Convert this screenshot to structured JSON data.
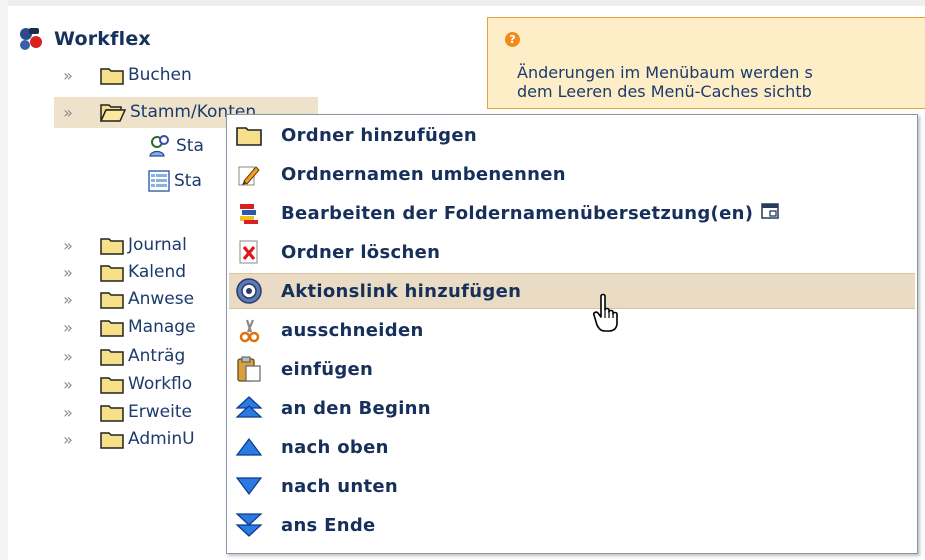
{
  "tree": {
    "root_label": "Workflex",
    "items": [
      {
        "label": "Buchen",
        "expanded": false
      },
      {
        "label": "Stamm/Konten",
        "expanded": true
      },
      {
        "label": "Journal",
        "expanded": false
      },
      {
        "label": "Kalend",
        "expanded": false
      },
      {
        "label": "Anwese",
        "expanded": false
      },
      {
        "label": "Manage",
        "expanded": false
      },
      {
        "label": "Anträg",
        "expanded": false
      },
      {
        "label": "Workflo",
        "expanded": false
      },
      {
        "label": "Erweite",
        "expanded": false
      },
      {
        "label": "AdminU",
        "expanded": false
      }
    ],
    "subitems": [
      {
        "label": "Sta",
        "icon": "users-icon"
      },
      {
        "label": "Sta",
        "icon": "list-icon"
      }
    ]
  },
  "info": {
    "line1": "Änderungen im Menübaum werden s",
    "line2": "dem Leeren des Menü-Caches sichtb"
  },
  "context_menu": {
    "items": [
      {
        "label": "Ordner hinzufügen",
        "icon": "folder-icon"
      },
      {
        "label": "Ordnernamen umbenennen",
        "icon": "pencil-icon"
      },
      {
        "label": "Bearbeiten der Foldernamenübersetzung(en)",
        "icon": "translate-icon"
      },
      {
        "label": "Ordner löschen",
        "icon": "delete-icon"
      },
      {
        "label": "Aktionslink hinzufügen",
        "icon": "action-link-icon"
      },
      {
        "label": "ausschneiden",
        "icon": "scissors-icon"
      },
      {
        "label": "einfügen",
        "icon": "paste-icon"
      },
      {
        "label": "an den Beginn",
        "icon": "move-top-icon"
      },
      {
        "label": "nach oben",
        "icon": "move-up-icon"
      },
      {
        "label": "nach unten",
        "icon": "move-down-icon"
      },
      {
        "label": "ans Ende",
        "icon": "move-bottom-icon"
      }
    ],
    "highlighted_index": 4
  },
  "colors": {
    "accent": "#f08a1c",
    "highlight": "#eadcc4",
    "text": "#17305b",
    "info_bg": "#fdeec8"
  }
}
